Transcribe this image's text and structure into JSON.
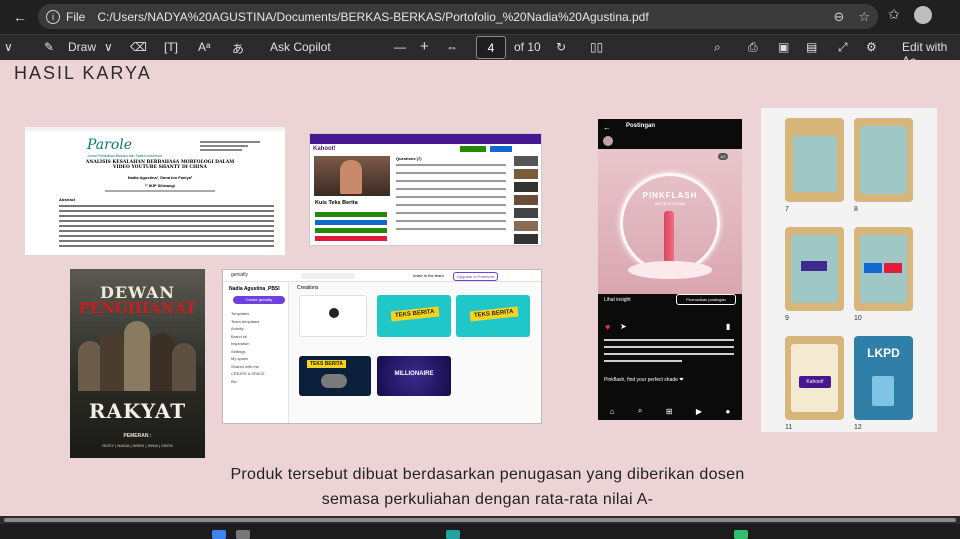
{
  "browser": {
    "scheme": "File",
    "url": "C:/Users/NADYA%20AGUSTINA/Documents/BERKAS-BERKAS/Portofolio_%20Nadia%20Agustina.pdf"
  },
  "toolbar": {
    "draw_label": "Draw",
    "ask_copilot_label": "Ask Copilot",
    "page_current": "4",
    "page_total": "of 10",
    "edit_label": "Edit with Ac"
  },
  "page": {
    "section_title": "HASIL KARYA",
    "caption_line1": "Produk tersebut dibuat berdasarkan penugasan yang diberikan dosen",
    "caption_line2": "semasa perkuliahan dengan rata-rata nilai A-"
  },
  "thumbs": {
    "journal": {
      "logo": "Parole",
      "logo_sub": "Jurnal Pendidikan Bahasa dan Sastra Indonesia",
      "title": "ANALISIS KESALAHAN BERBAHASA MORFOLOGI DALAM VIDEO YOUTUBE SHANTY DI CHINA",
      "authors": "Nadia Agustina¹, Dana Ion Faniya²",
      "affiliation": "¹² IKIP Siliwangi",
      "abstract_label": "Abstract"
    },
    "kahoot": {
      "brand": "Kahoot!",
      "quiz_title": "Kuis Teks Berita",
      "questions_label": "Questions (7)"
    },
    "poster": {
      "top_word": "DEWAN",
      "middle_word": "PENGHIANAT",
      "bottom_word": "RAKYAT",
      "crew_label": "PEMERAN :",
      "crew_names": "RIZKY | NADIA | WINDI | SINIA | SINTA"
    },
    "genially": {
      "brand": "genially",
      "user_name": "Nadia Agustina_PBSI",
      "create_label": "Create genially",
      "creations_label": "Creations",
      "invite_label": "Invite to the team",
      "upgrade_label": "Upgrade to Premium",
      "tile_labels": [
        "TEKS BERITA",
        "TEKS BERITA",
        "TEKS BERITA",
        "MILLIONAIRE"
      ],
      "menu": [
        "Templates",
        "Team templates",
        "Activity",
        "Brand kit",
        "Inspiration",
        "Settings",
        "My space",
        "Shared with me",
        "CREATE A SPACE",
        "Bin"
      ]
    },
    "instagram": {
      "header": "Postingan",
      "product_name": "PINKFLASH",
      "product_sub": "MATTE LIPCREAM",
      "counter": "1/2",
      "insight_label": "Lihat insight",
      "promote_label": "Promosikan postingan",
      "caption": "PinkFlash, find your perfect shade",
      "caption_long": "Pinkflash, find your perfect shade ❤"
    },
    "lkpd": {
      "page_numbers": [
        "7",
        "8",
        "9",
        "10",
        "11",
        "12"
      ],
      "cover_title": "LKPD",
      "kahoot_button": "Kahoot!"
    }
  },
  "colors": {
    "page_bg": "#ecd4d6",
    "kahoot_purple": "#46178f",
    "teks_berita_teal": "#1fc7c8",
    "teks_berita_yellow": "#f6d31c",
    "genially_accent": "#6c3fe0",
    "instagram_bg": "#0b0b0b",
    "lkpd_tan": "#d6b67a"
  }
}
